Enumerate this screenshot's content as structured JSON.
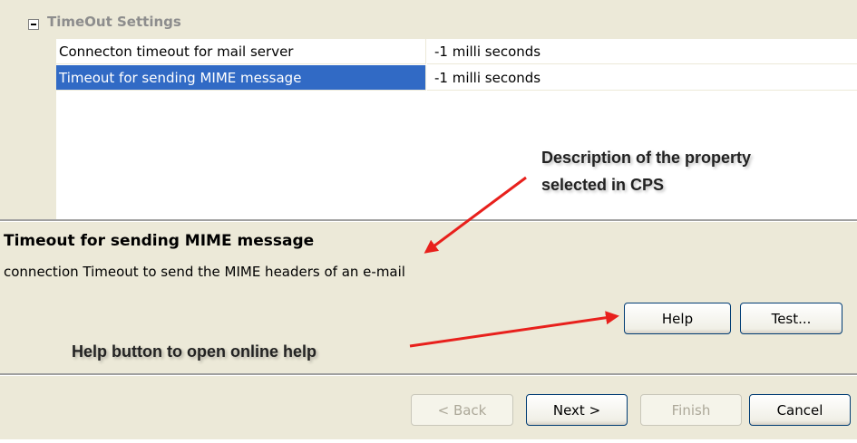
{
  "property_sheet": {
    "category": "TimeOut Settings",
    "rows": [
      {
        "name": "Connecton timeout for mail server",
        "value": "-1  milli seconds"
      },
      {
        "name": "Timeout for sending MIME message",
        "value": "-1  milli seconds"
      }
    ],
    "selected_row": 1
  },
  "description": {
    "title": "Timeout for sending MIME message",
    "text": "connection Timeout to send the MIME headers of an e-mail"
  },
  "buttons": {
    "help": "Help",
    "test": "Test...",
    "back": "< Back",
    "next": "Next >",
    "finish": "Finish",
    "cancel": "Cancel"
  },
  "annotations": {
    "description_callout": [
      "Description of the property",
      "selected in CPS"
    ],
    "help_callout": "Help button to open online help",
    "arrow_color": "#e8201c"
  },
  "colors": {
    "selection": "#316ac5",
    "dialog_background": "#ece9d8"
  }
}
